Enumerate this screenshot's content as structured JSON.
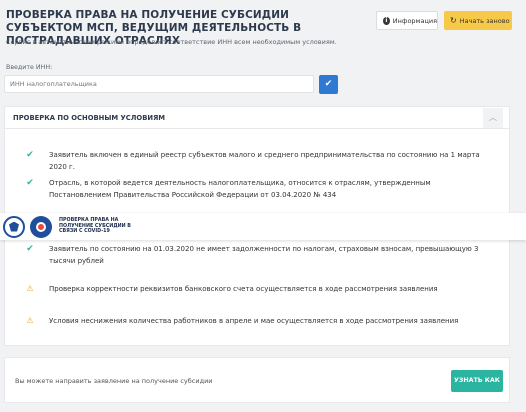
{
  "header": {
    "title": "Проверка права на получение субсидии субъектом МСП, ведущим деятельность в пострадавших отраслях",
    "info_label": "Информация",
    "restart_label": "Начать заново",
    "subtitle": "Сервис в автоматическом режиме определяет соответствие ИНН всем необходимым условиям."
  },
  "inn": {
    "label": "Введите ИНН:",
    "placeholder": "ИНН налогоплательщика",
    "value": "",
    "submit_icon": "check-icon"
  },
  "panel": {
    "title": "Проверка по основным условиям",
    "collapse_icon": "chevron-up-icon",
    "conditions": [
      {
        "status": "ok",
        "text": "Заявитель включен в единый реестр субъектов малого и среднего предпринимательства по состоянию на 1 марта 2020 г."
      },
      {
        "status": "ok",
        "text": "Отрасль, в которой ведется деятельность налогоплательщика, относится к отраслям, утвержденным Постановлением Правительства Российской Федерации от 03.04.2020 № 434"
      },
      {
        "status": "ok",
        "text": "Заявитель по состоянию на 01.03.2020 не имеет задолженности по налогам, страховым взносам, превышающую 3 тысячи рублей"
      },
      {
        "status": "warn",
        "text": "Проверка корректности реквизитов банковского счета осуществляется в ходе рассмотрения заявления"
      },
      {
        "status": "warn",
        "text": "Условия неснижения количества работников в апреле и мае осуществляется в ходе рассмотрения заявления"
      }
    ]
  },
  "banner": {
    "text": "Проверка права на получение субсидии в связи с COVID-19"
  },
  "footer": {
    "text": "Вы можете направить заявление на получение субсидии",
    "apply_label": "Узнать как"
  },
  "colors": {
    "accent_blue": "#2e79d4",
    "success": "#2bb5a0",
    "warning": "#f0a23a",
    "restart_bg": "#f7c948"
  }
}
